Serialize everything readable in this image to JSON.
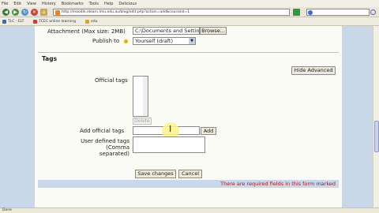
{
  "browser": {
    "menu": [
      "File",
      "Edit",
      "View",
      "History",
      "Bookmarks",
      "Tools",
      "Help",
      "Delicious"
    ],
    "url": "http://moodle.elearn.lmu.edu.au/blog/edit.php?action=add&courseid=1",
    "bookmarks": [
      "TLC - ELT",
      "TCEC online learning",
      "edu"
    ],
    "status": "Done"
  },
  "form": {
    "attachment_label": "Attachment (Max size: 2MB)",
    "attachment_value": "C:\\Documents and Settin",
    "browse_label": "Browse...",
    "publish_label": "Publish to",
    "publish_value": "Yourself (draft)",
    "tags_legend": "Tags",
    "hide_advanced_label": "Hide Advanced",
    "official_tags_label": "Official tags",
    "delete_label": "Delete",
    "add_official_tags_label": "Add official tags",
    "add_label": "Add",
    "user_defined_tags_label_1": "User defined tags (Comma",
    "user_defined_tags_label_2": "separated)",
    "save_label": "Save changes",
    "cancel_label": "Cancel",
    "required_text": "There are required fields in this form marked"
  },
  "colors": {
    "side_strip": "#c8d8e8",
    "required_text": "#a02020"
  }
}
